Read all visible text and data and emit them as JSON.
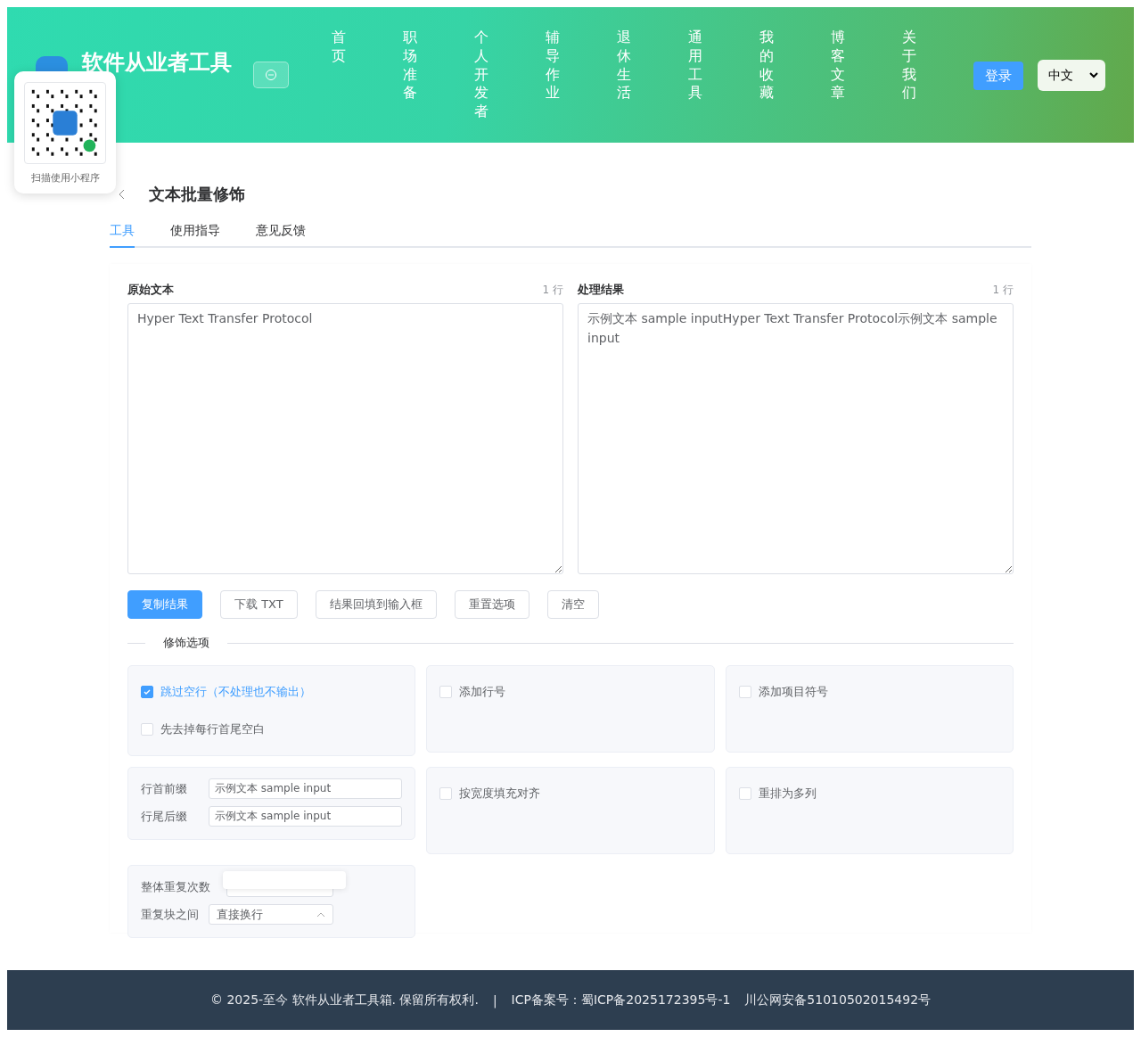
{
  "header": {
    "site_title": "软件从业者工具",
    "nav": [
      {
        "label": "首页",
        "selected": false
      },
      {
        "label": "职场准备",
        "selected": false
      },
      {
        "label": "个人开发者",
        "selected": false
      },
      {
        "label": "辅导作业",
        "selected": false
      },
      {
        "label": "退休生活",
        "selected": false
      },
      {
        "label": "通用工具",
        "selected": false
      },
      {
        "label": "我的收藏",
        "selected": false
      },
      {
        "label": "博客文章",
        "selected": false
      },
      {
        "label": "关于我们",
        "selected": false
      }
    ],
    "login_button": "登录",
    "language": "中文"
  },
  "qr_popup": {
    "caption": "扫描使用小程序"
  },
  "page": {
    "title": "文本批量修饰",
    "tabs": [
      {
        "label": "工具",
        "selected": true
      },
      {
        "label": "使用指导",
        "selected": false
      },
      {
        "label": "意见反馈",
        "selected": false
      }
    ],
    "input": {
      "label": "原始文本",
      "count": "1 行",
      "value": "Hyper Text Transfer Protocol"
    },
    "output": {
      "label": "处理结果",
      "count": "1 行",
      "value": "示例文本 sample inputHyper Text Transfer Protocol示例文本 sample input"
    },
    "actions": [
      {
        "label": "复制结果",
        "primary": true
      },
      {
        "label": "下载 TXT",
        "primary": false
      },
      {
        "label": "结果回填到输入框",
        "primary": false
      },
      {
        "label": "重置选项",
        "primary": false
      },
      {
        "label": "清空",
        "primary": false
      }
    ],
    "options_title": "修饰选项",
    "option_cards": [
      {
        "items": [
          {
            "kind": "checkbox",
            "label": "跳过空行（不处理也不输出）",
            "checked": true
          },
          {
            "kind": "checkbox",
            "label": "先去掉每行首尾空白",
            "checked": false
          }
        ]
      },
      {
        "items": [
          {
            "kind": "checkbox",
            "label": "添加行号",
            "checked": false
          }
        ]
      },
      {
        "items": [
          {
            "kind": "checkbox",
            "label": "添加项目符号",
            "checked": false
          }
        ]
      },
      {
        "items": [
          {
            "kind": "text",
            "label": "行首前缀",
            "value": "示例文本 sample input"
          },
          {
            "kind": "text",
            "label": "行尾后缀",
            "value": "示例文本 sample input"
          }
        ]
      },
      {
        "items": [
          {
            "kind": "checkbox",
            "label": "按宽度填充对齐",
            "checked": false
          }
        ]
      },
      {
        "items": [
          {
            "kind": "checkbox",
            "label": "重排为多列",
            "checked": false
          }
        ]
      },
      {
        "items": [
          {
            "kind": "stepper",
            "label": "整体重复次数"
          },
          {
            "kind": "select",
            "label": "重复块之间",
            "value": "直接换行"
          }
        ]
      }
    ]
  },
  "footer": {
    "copyright": "© 2025-至今 软件从业者工具箱. 保留所有权利.",
    "separator": "|",
    "icp": "ICP备案号：蜀ICP备2025172395号-1",
    "police": "川公网安备51010502015492号"
  }
}
